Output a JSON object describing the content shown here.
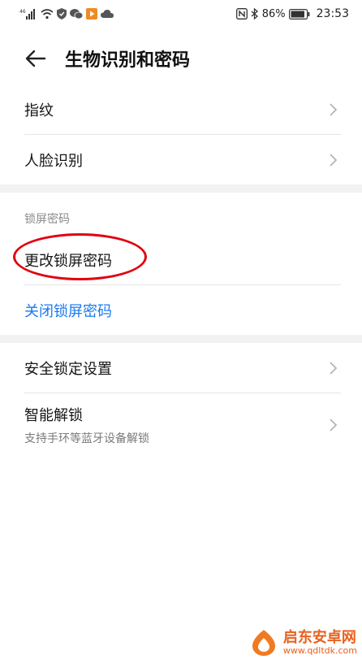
{
  "status_bar": {
    "battery": "86%",
    "time": "23:53",
    "left_icons": [
      "signal-icon",
      "wifi-icon",
      "shield-icon",
      "wechat-icon",
      "video-icon",
      "cloud-icon"
    ],
    "right_icons": [
      "nfc-icon",
      "bluetooth-icon",
      "battery-icon"
    ]
  },
  "header": {
    "title": "生物识别和密码"
  },
  "items": {
    "fingerprint": "指纹",
    "face": "人脸识别"
  },
  "lock_section": {
    "header": "锁屏密码",
    "change": "更改锁屏密码",
    "close": "关闭锁屏密码"
  },
  "security": {
    "lock_settings": "安全锁定设置",
    "smart_unlock": "智能解锁",
    "smart_unlock_sub": "支持手环等蓝牙设备解锁"
  },
  "watermark": {
    "name": "启东安卓网",
    "url": "www.qdltdk.com"
  },
  "colors": {
    "link": "#1a7af0",
    "annotation": "#e00010",
    "section_gap": "#f2f2f2"
  }
}
